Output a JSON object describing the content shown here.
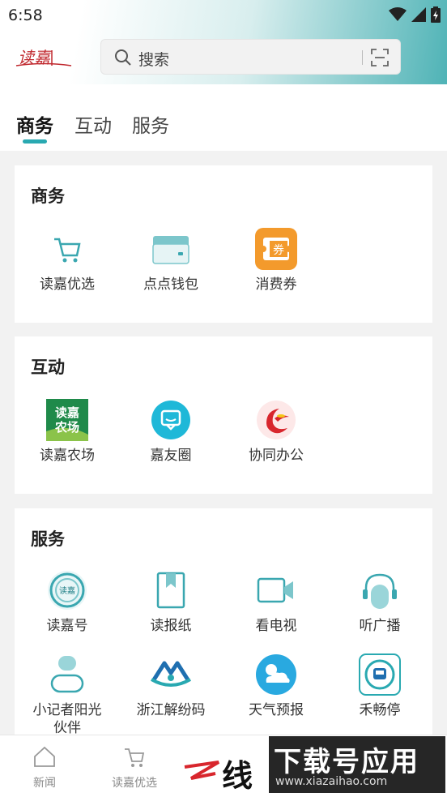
{
  "status_bar": {
    "time": "6:58"
  },
  "header": {
    "logo_text": "读嘉",
    "search_placeholder": "搜索"
  },
  "tabs": [
    {
      "label": "商务",
      "active": true
    },
    {
      "label": "互动",
      "active": false
    },
    {
      "label": "服务",
      "active": false
    }
  ],
  "sections": {
    "business": {
      "title": "商务",
      "items": [
        {
          "label": "读嘉优选",
          "icon": "cart-icon"
        },
        {
          "label": "点点钱包",
          "icon": "wallet-icon"
        },
        {
          "label": "消费券",
          "icon": "coupon-icon",
          "badge": "券"
        }
      ]
    },
    "interaction": {
      "title": "互动",
      "items": [
        {
          "label": "读嘉农场",
          "icon": "farm-icon",
          "badge_line1": "读嘉",
          "badge_line2": "农场"
        },
        {
          "label": "嘉友圈",
          "icon": "chat-bubble-icon"
        },
        {
          "label": "协同办公",
          "icon": "office-logo-icon"
        }
      ]
    },
    "service": {
      "title": "服务",
      "items": [
        {
          "label": "读嘉号",
          "icon": "dujia-emblem-icon",
          "badge": "读嘉"
        },
        {
          "label": "读报纸",
          "icon": "newspaper-icon"
        },
        {
          "label": "看电视",
          "icon": "video-camera-icon"
        },
        {
          "label": "听广播",
          "icon": "headphones-icon"
        },
        {
          "label": "小记者阳光伙伴",
          "icon": "reporter-icon"
        },
        {
          "label": "浙江解纷码",
          "icon": "dispute-code-icon"
        },
        {
          "label": "天气预报",
          "icon": "weather-icon"
        },
        {
          "label": "禾畅停",
          "icon": "parking-icon"
        }
      ]
    }
  },
  "bottom_nav": [
    {
      "label": "新闻",
      "icon": "home-icon"
    },
    {
      "label": "读嘉优选",
      "icon": "cart-icon"
    }
  ],
  "watermark": {
    "logo": "线",
    "title": "下载号应用",
    "url": "www.xiazaihao.com"
  },
  "colors": {
    "accent": "#29a9b1",
    "coupon": "#f39a2c",
    "farm": "#1f8a4a",
    "weather": "#29a9e0"
  }
}
